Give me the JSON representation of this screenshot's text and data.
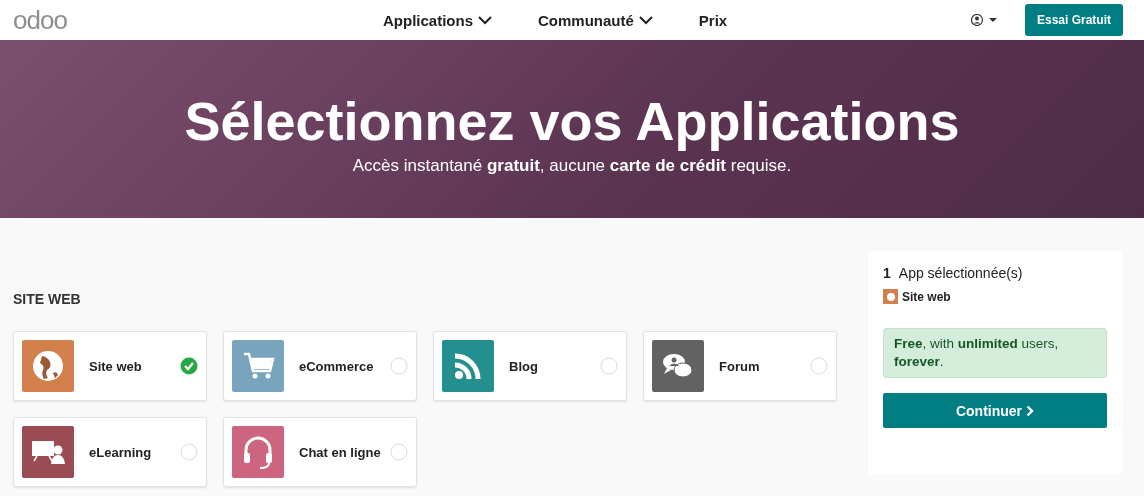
{
  "logo": "odoo",
  "nav": {
    "items": [
      {
        "label": "Applications",
        "dropdown": true
      },
      {
        "label": "Communauté",
        "dropdown": true
      },
      {
        "label": "Prix",
        "dropdown": false
      }
    ],
    "cta": "Essai Gratuit"
  },
  "hero": {
    "title": "Sélectionnez vos Applications",
    "subtitle": "Accès instantané **gratuit**, aucune **carte de crédit** requise."
  },
  "section": {
    "title": "SITE WEB",
    "apps": [
      {
        "name": "Site web",
        "kind": "globe",
        "color": "#d4804c",
        "selected": true
      },
      {
        "name": "eCommerce",
        "kind": "cart",
        "color": "#78a4bd",
        "selected": false
      },
      {
        "name": "Blog",
        "kind": "rss",
        "color": "#23908f",
        "selected": false
      },
      {
        "name": "Forum",
        "kind": "chat",
        "color": "#626262",
        "selected": false
      },
      {
        "name": "eLearning",
        "kind": "board",
        "color": "#9b4b52",
        "selected": false
      },
      {
        "name": "Chat en ligne",
        "kind": "headset",
        "color": "#cd6580",
        "selected": false
      }
    ]
  },
  "summary": {
    "count": "1",
    "label": "App sélectionnée(s)",
    "apps": [
      {
        "name": "Site web",
        "color": "#d4804c"
      }
    ],
    "notice": "**Free**, with **unlimited** users, **forever**.",
    "button": "Continuer"
  }
}
